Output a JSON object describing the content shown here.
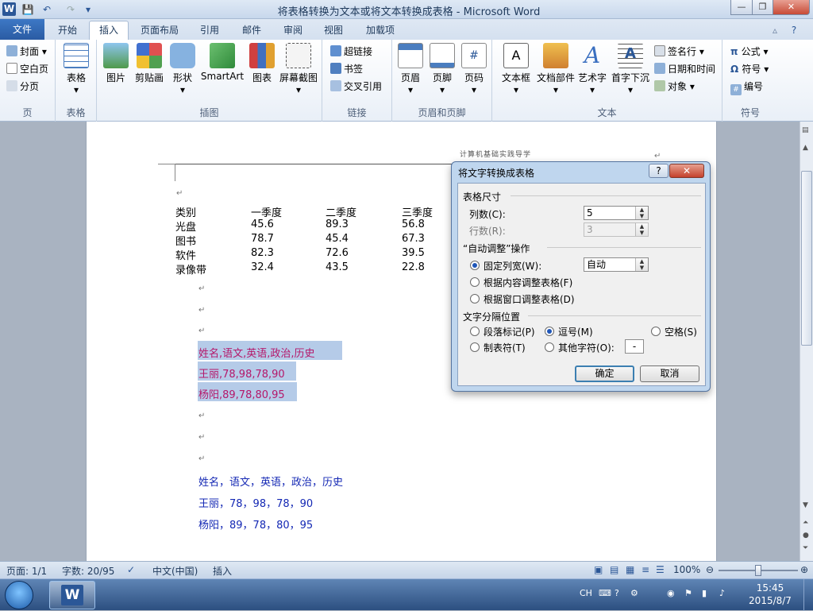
{
  "window": {
    "title": "将表格转换为文本或将文本转换成表格 - Microsoft Word",
    "app_icon": "W"
  },
  "tabs": [
    "文件",
    "开始",
    "插入",
    "页面布局",
    "引用",
    "邮件",
    "审阅",
    "视图",
    "加载项"
  ],
  "ribbon": {
    "page_group": {
      "label": "页",
      "items": [
        "封面",
        "空白页",
        "分页"
      ]
    },
    "table_group": {
      "label": "表格",
      "items": [
        "表格"
      ]
    },
    "illus_group": {
      "label": "插图",
      "items": [
        "图片",
        "剪贴画",
        "形状",
        "SmartArt",
        "图表",
        "屏幕截图"
      ]
    },
    "link_group": {
      "label": "链接",
      "items": [
        "超链接",
        "书签",
        "交叉引用"
      ]
    },
    "hf_group": {
      "label": "页眉和页脚",
      "items": [
        "页眉",
        "页脚",
        "页码"
      ]
    },
    "text_group": {
      "label": "文本",
      "items": [
        "文本框",
        "文档部件",
        "艺术字",
        "首字下沉",
        "签名行",
        "日期和时间",
        "对象"
      ]
    },
    "sym_group": {
      "label": "符号",
      "items": [
        "公式",
        "符号",
        "编号"
      ]
    }
  },
  "document": {
    "header_text": "计算机基础实践导学",
    "table": {
      "headers": [
        "类别",
        "一季度",
        "二季度",
        "三季度"
      ],
      "rows": [
        [
          "光盘",
          "45.6",
          "89.3",
          "56.8"
        ],
        [
          "图书",
          "78.7",
          "45.4",
          "67.3"
        ],
        [
          "软件",
          "82.3",
          "72.6",
          "39.5"
        ],
        [
          "录像带",
          "32.4",
          "43.5",
          "22.8"
        ]
      ]
    },
    "selected_lines": [
      "姓名,语文,英语,政治,历史",
      "王丽,78,98,78,90",
      "杨阳,89,78,80,95"
    ],
    "blue_lines": [
      "姓名，语文，英语，政治，历史",
      "王丽，78，98，78，90",
      "杨阳，89，78，80，95"
    ],
    "para_mark": "↵"
  },
  "dialog": {
    "title": "将文字转换成表格",
    "help": "?",
    "close": "✕",
    "size_section": "表格尺寸",
    "cols_label": "列数(C):",
    "cols_value": "5",
    "rows_label": "行数(R):",
    "rows_value": "3",
    "autofit_section": "“自动调整”操作",
    "fixed_width": "固定列宽(W):",
    "fixed_value": "自动",
    "fit_content": "根据内容调整表格(F)",
    "fit_window": "根据窗口调整表格(D)",
    "sep_section": "文字分隔位置",
    "sep_para": "段落标记(P)",
    "sep_comma": "逗号(M)",
    "sep_space": "空格(S)",
    "sep_tab": "制表符(T)",
    "sep_other": "其他字符(O):",
    "other_value": "-",
    "ok": "确定",
    "cancel": "取消"
  },
  "status": {
    "page": "页面: 1/1",
    "words": "字数: 20/95",
    "lang": "中文(中国)",
    "mode": "插入",
    "zoom": "100%"
  },
  "taskbar": {
    "ime": "CH",
    "time": "15:45",
    "date": "2015/8/7"
  }
}
